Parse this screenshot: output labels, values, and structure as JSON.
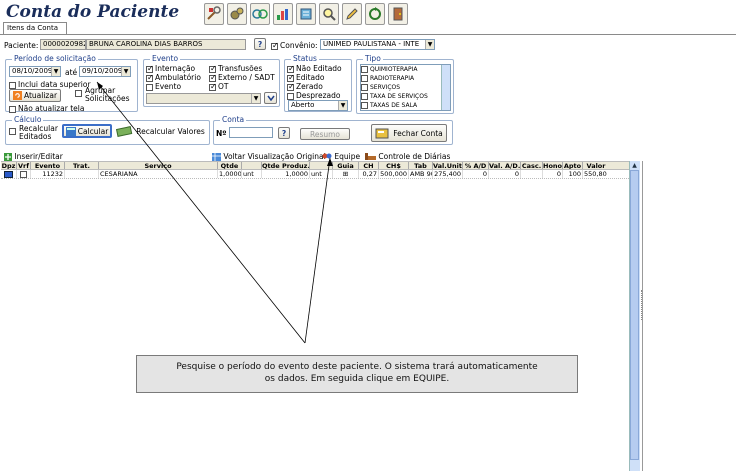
{
  "header": {
    "title": "Conta do Paciente",
    "tab_label": "Itens da Conta"
  },
  "patient": {
    "label": "Paciente:",
    "id": "0000020982",
    "name": "BRUNA CAROLINA DIAS BARROS",
    "help": "?",
    "convenio_label": "Convênio:",
    "convenio_value": "UNIMED PAULISTANA - INTE"
  },
  "periodo": {
    "title": "Período de solicitação",
    "from": "08/10/2009",
    "ate_label": "até",
    "to": "09/10/2009",
    "incluir_data_superior": "Inclui data superior",
    "agrupar": "Agrupar Solicitações",
    "atualizar": "Atualizar",
    "nao_atualizar": "Não atualizar tela"
  },
  "evento": {
    "title": "Evento",
    "options": [
      "Internação",
      "Ambulatório",
      "Evento"
    ],
    "options_right": [
      "Transfusões",
      "Externo / SADT",
      "OT"
    ]
  },
  "status": {
    "title": "Status",
    "options": [
      "Não Editado",
      "Editado",
      "Zerado",
      "Desprezado"
    ],
    "select": "Aberto"
  },
  "tipo": {
    "title": "Tipo",
    "items": [
      "QUIMIOTERAPIA",
      "RADIOTERAPIA",
      "SERVIÇOS",
      "TAXA DE SERVIÇOS",
      "TAXAS DE SALA"
    ]
  },
  "calculo": {
    "title": "Cálculo",
    "recalcular_editados": "Recalcular Editados",
    "calcular": "Calcular",
    "recalcular_valores": "Recalcular Valores"
  },
  "conta": {
    "title": "Conta",
    "n_label": "Nº",
    "help": "?",
    "resumo": "Resumo",
    "fechar": "Fechar Conta"
  },
  "gridbar": {
    "inserir": "Inserir/Editar",
    "voltar": "Voltar Visualização Original",
    "equipe": "Equipe",
    "controle": "Controle de Diárias"
  },
  "grid": {
    "columns": [
      "Dpz",
      "Vrf",
      "Evento",
      "Trat.",
      "Serviço",
      "Qtde",
      "",
      "Qtde Produz.",
      "",
      "Guia",
      "CH",
      "CH$",
      "Tab",
      "Val.Unit.",
      "% A/D",
      "Val. A/D.",
      "Casc.",
      "Honor",
      "Apto",
      "Valor"
    ],
    "rows": [
      [
        "",
        "",
        "11232",
        "",
        "CESARIANA",
        "1,0000",
        "unt",
        "1,0000",
        "unt",
        "⊞",
        "0,27",
        "500,000",
        "AMB 90",
        "275,400",
        "0",
        "0",
        "",
        "0",
        "100",
        "550,80 Fr"
      ]
    ]
  },
  "tooltip": {
    "line1": "Pesquise o período do evento deste paciente. O sistema trará automaticamente",
    "line2": "os dados. Em seguida clique em EQUIPE."
  },
  "colors": {
    "accent": "#1f3f8a",
    "title": "#1a2d5a",
    "scroll": "#cfe0f8"
  }
}
